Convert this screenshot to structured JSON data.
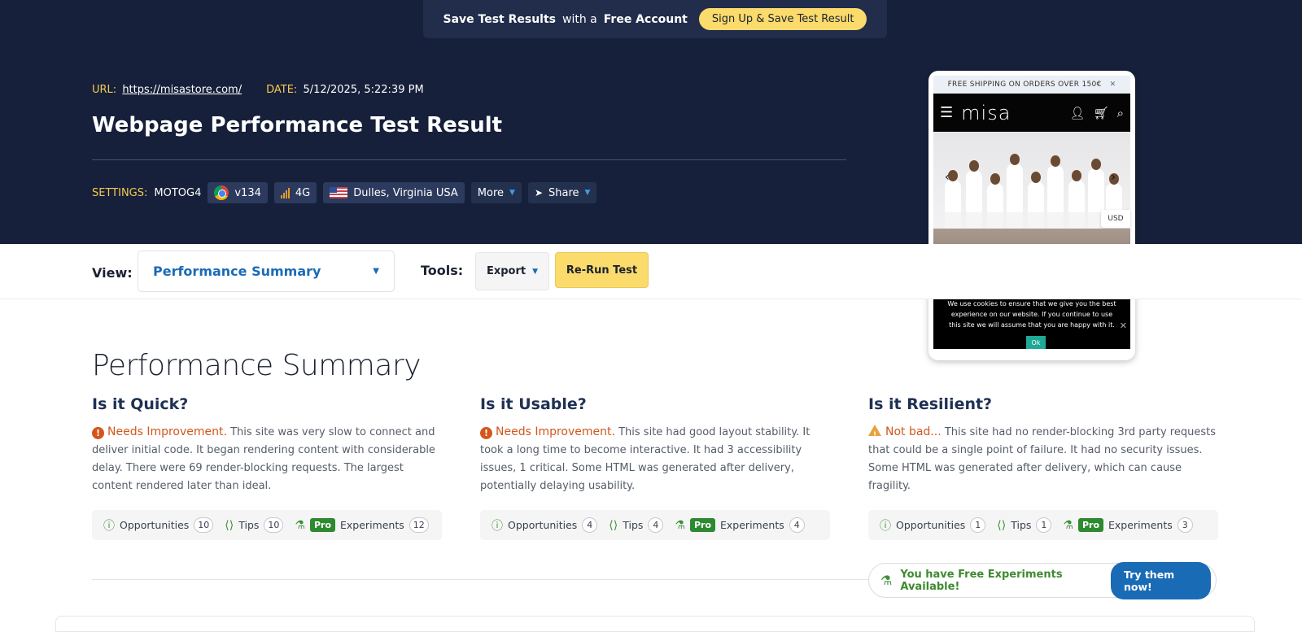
{
  "promo": {
    "text_bold_1": "Save Test Results",
    "text_mid": "with a",
    "text_bold_2": "Free Account",
    "button": "Sign Up & Save Test Result"
  },
  "meta": {
    "url_label": "URL:",
    "url": "https://misastore.com/",
    "date_label": "DATE:",
    "date": "5/12/2025, 5:22:39 PM"
  },
  "title": "Webpage Performance Test Result",
  "settings": {
    "label": "SETTINGS:",
    "device": "MOTOG4",
    "browser": "v134",
    "connection": "4G",
    "location": "Dulles, Virginia USA",
    "more": "More",
    "share": "Share"
  },
  "preview": {
    "shipping": "FREE SHIPPING ON ORDERS OVER 150€",
    "logo": "misa",
    "currency": "USD",
    "cookie": "We use cookies to ensure that we give you the best experience on our website. If you continue to use this site we will assume that you are happy with it.",
    "ok": "Ok"
  },
  "toolbar": {
    "view_label": "View:",
    "view_value": "Performance Summary",
    "tools_label": "Tools:",
    "export": "Export",
    "rerun": "Re-Run Test"
  },
  "summary": {
    "title": "Performance Summary",
    "columns": [
      {
        "heading": "Is it Quick?",
        "status": "Needs Improvement.",
        "text": "This site was very slow to connect and deliver initial code. It began rendering content with considerable delay. There were 69 render-blocking requests. The largest content rendered later than ideal.",
        "opportunities_label": "Opportunities",
        "opportunities": "10",
        "tips_label": "Tips",
        "tips": "10",
        "pro_label": "Pro",
        "experiments_label": "Experiments",
        "experiments": "12"
      },
      {
        "heading": "Is it Usable?",
        "status": "Needs Improvement.",
        "text": "This site had good layout stability. It took a long time to become interactive. It had 3 accessibility issues, 1 critical. Some HTML was generated after delivery, potentially delaying usability.",
        "opportunities_label": "Opportunities",
        "opportunities": "4",
        "tips_label": "Tips",
        "tips": "4",
        "pro_label": "Pro",
        "experiments_label": "Experiments",
        "experiments": "4"
      },
      {
        "heading": "Is it Resilient?",
        "status": "Not bad...",
        "text": "This site had no render-blocking 3rd party requests that could be a single point of failure. It had no security issues. Some HTML was generated after delivery, which can cause fragility.",
        "opportunities_label": "Opportunities",
        "opportunities": "1",
        "tips_label": "Tips",
        "tips": "1",
        "pro_label": "Pro",
        "experiments_label": "Experiments",
        "experiments": "3"
      }
    ]
  },
  "free_experiments": {
    "text": "You have Free Experiments Available!",
    "button": "Try them now!"
  },
  "colors": {
    "header_bg": "#16203a",
    "accent_yellow": "#fbdb6b",
    "link_blue": "#1a6bb5",
    "warning_orange": "#d3561c",
    "pro_green": "#2e8a30"
  }
}
